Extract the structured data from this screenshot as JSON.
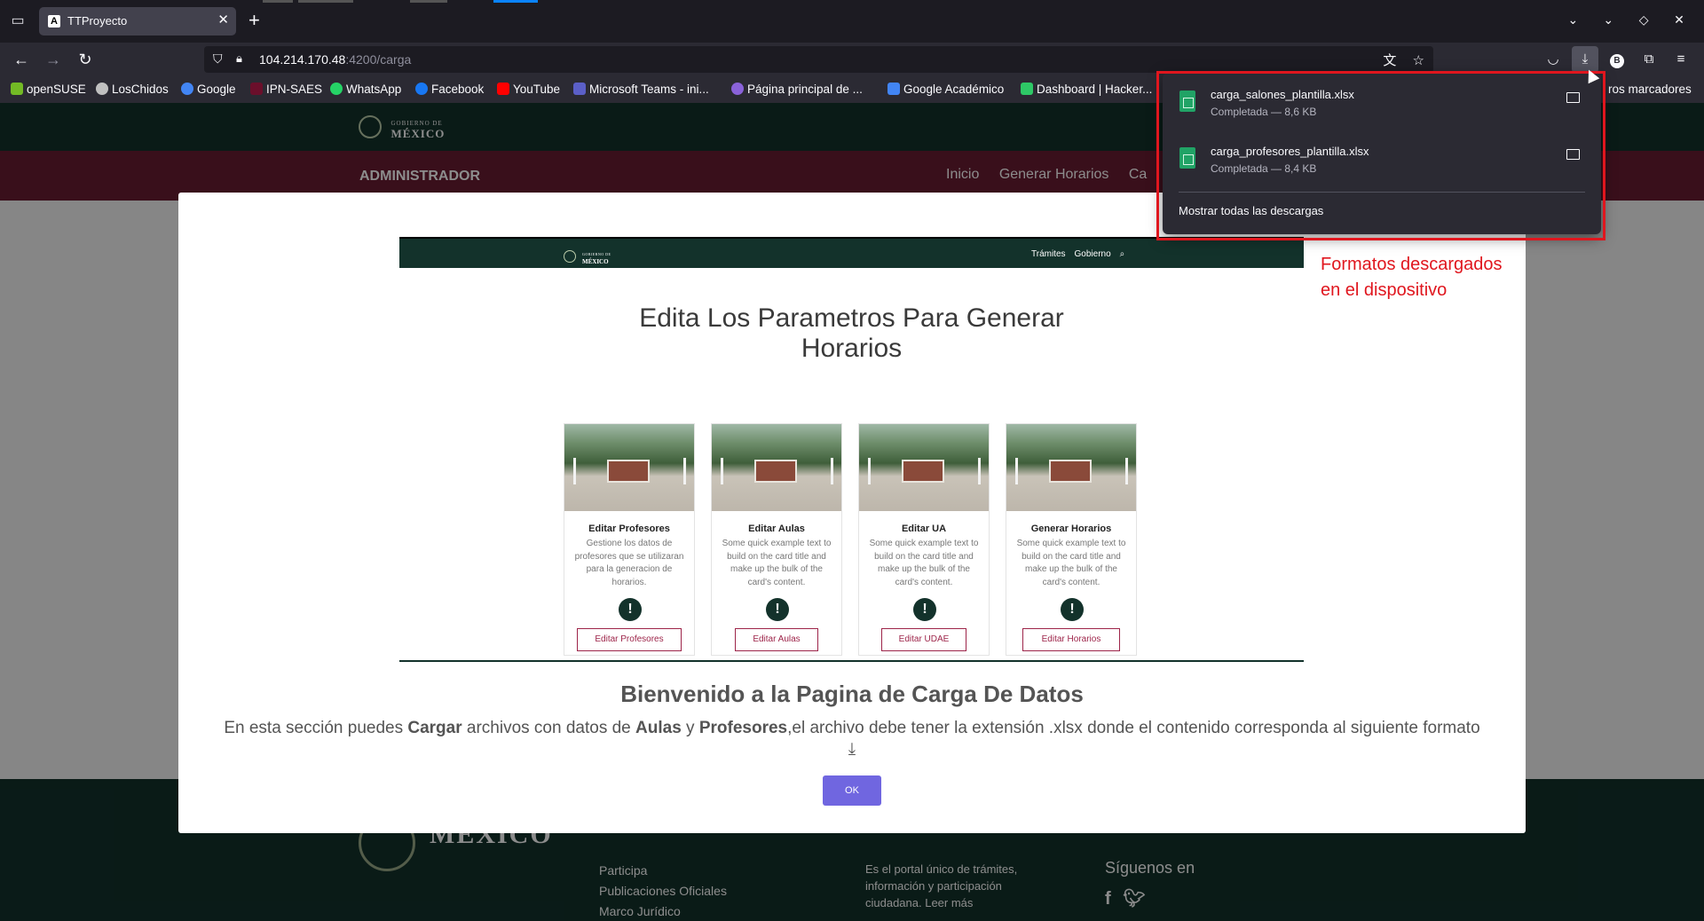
{
  "browser": {
    "tab_title": "TTProyecto",
    "tab_favicon": "A",
    "url_host": "104.214.170.48",
    "url_path": ":4200/carga",
    "profile_initial": "B"
  },
  "bookmarks": [
    {
      "label": "openSUSE",
      "color": "#73ba25"
    },
    {
      "label": "LosChidos",
      "color": "#c0c0c0"
    },
    {
      "label": "Google",
      "color": "#4285f4"
    },
    {
      "label": "IPN-SAES",
      "color": "#6b0f2b"
    },
    {
      "label": "WhatsApp",
      "color": "#25d366"
    },
    {
      "label": "Facebook",
      "color": "#1877f2"
    },
    {
      "label": "YouTube",
      "color": "#ff0000"
    },
    {
      "label": "Microsoft Teams - ini...",
      "color": "#5b5fc7"
    },
    {
      "label": "Página principal de ...",
      "color": "#8a62d9"
    },
    {
      "label": "Google Académico",
      "color": "#4285f4"
    },
    {
      "label": "Dashboard | Hacker...",
      "color": "#2ec866"
    },
    {
      "label": "ros marcadores",
      "color": ""
    }
  ],
  "page": {
    "gob_small": "GOBIERNO DE",
    "gob_large": "MÉXICO",
    "admin_title": "ADMINISTRADOR",
    "nav": [
      "Inicio",
      "Generar Horarios",
      "Ca"
    ],
    "footer_logo": "MÉXICO",
    "footer_links": [
      "Participa",
      "Publicaciones Oficiales",
      "Marco Jurídico"
    ],
    "footer_desc": "Es el portal único de trámites, información y participación ciudadana. Leer más",
    "footer_follow": "Síguenos en",
    "footer_social": "f"
  },
  "modal": {
    "shot": {
      "logo_small": "GOBIERNO DE",
      "logo_large": "MÉXICO",
      "nav": [
        "Trámites",
        "Gobierno"
      ],
      "title_line1": "Edita Los Parametros Para Generar",
      "title_line2": "Horarios",
      "cards": [
        {
          "title": "Editar Profesores",
          "text": "Gestione los datos de profesores que se utilizaran para la generacion de horarios.",
          "button": "Editar Profesores"
        },
        {
          "title": "Editar Aulas",
          "text": "Some quick example text to build on the card title and make up the bulk of the card's content.",
          "button": "Editar Aulas"
        },
        {
          "title": "Editar UA",
          "text": "Some quick example text to build on the card title and make up the bulk of the card's content.",
          "button": "Editar UDAE"
        },
        {
          "title": "Generar Horarios",
          "text": "Some quick example text to build on the card title and make up the bulk of the card's content.",
          "button": "Editar Horarios"
        }
      ]
    },
    "title": "Bienvenido a la Pagina de Carga De Datos",
    "text_pre": "En esta sección puedes ",
    "bold1": "Cargar",
    "text_mid1": " archivos con datos de ",
    "bold2": "Aulas",
    "text_mid2": " y ",
    "bold3": "Profesores",
    "text_post": ",el archivo debe tener la extensión .xlsx donde el contenido corresponda al siguiente formato ",
    "ok_label": "OK"
  },
  "downloads": {
    "items": [
      {
        "name": "carga_salones_plantilla.xlsx",
        "status": "Completada — 8,6 KB"
      },
      {
        "name": "carga_profesores_plantilla.xlsx",
        "status": "Completada — 8,4 KB"
      }
    ],
    "show_all": "Mostrar todas las descargas"
  },
  "annotation": {
    "line1": "Formatos descargados",
    "line2": "en el dispositivo",
    "color": "#e0161e"
  }
}
